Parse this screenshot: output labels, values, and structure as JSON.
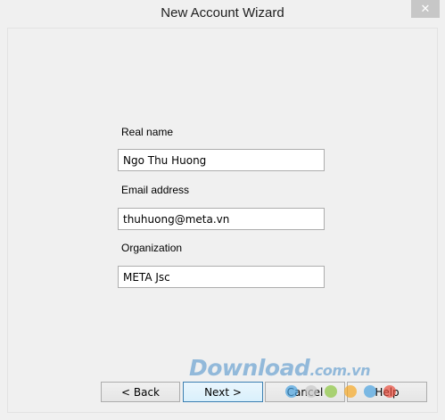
{
  "window": {
    "title": "New Account Wizard",
    "close_glyph": "✕"
  },
  "form": {
    "real_name": {
      "label": "Real name",
      "value": "Ngo Thu Huong"
    },
    "email": {
      "label": "Email address",
      "value": "thuhuong@meta.vn"
    },
    "organization": {
      "label": "Organization",
      "value": "META Jsc"
    }
  },
  "buttons": {
    "back": "< Back",
    "next": "Next >",
    "cancel": "Cancel",
    "help": "Help"
  },
  "watermark": {
    "main": "Download",
    "suffix": ".com.vn",
    "dot_colors": [
      "#4aa3df",
      "#c8c8c8",
      "#8cc63f",
      "#f7a823",
      "#4aa3df",
      "#e94b3c"
    ]
  }
}
